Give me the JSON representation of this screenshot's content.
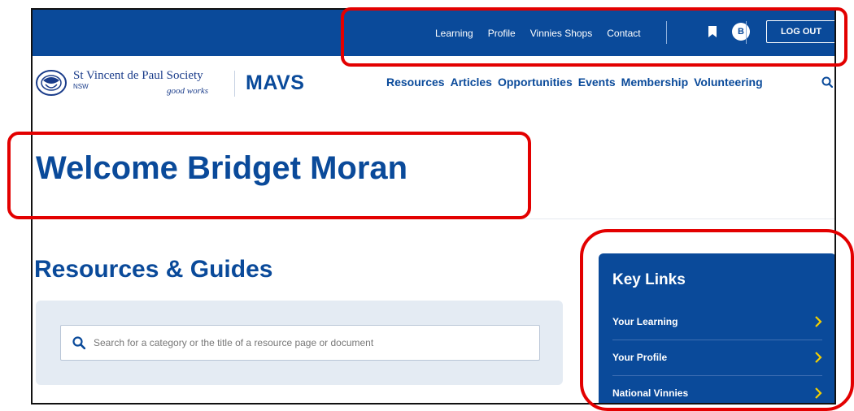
{
  "topbar": {
    "links": [
      "Learning",
      "Profile",
      "Vinnies Shops",
      "Contact"
    ],
    "avatar_initial": "B",
    "logout_label": "LOG OUT"
  },
  "header": {
    "org_name": "St Vincent de Paul Society",
    "org_region": "NSW",
    "tagline": "good works",
    "brand": "MAVS",
    "nav": [
      "Resources",
      "Articles",
      "Opportunities",
      "Events",
      "Membership",
      "Volunteering"
    ]
  },
  "welcome": {
    "title": "Welcome Bridget Moran"
  },
  "resources": {
    "title": "Resources & Guides",
    "search_placeholder": "Search for a category or the title of a resource page or document"
  },
  "key_links": {
    "title": "Key Links",
    "items": [
      "Your Learning",
      "Your Profile",
      "National Vinnies"
    ]
  },
  "colors": {
    "brand_blue": "#0a4a9a",
    "accent_yellow": "#f5d000",
    "highlight_red": "#e30000"
  },
  "icons": [
    "bookmark-icon",
    "search-icon",
    "chevron-right-icon",
    "svdp-logo-icon"
  ]
}
